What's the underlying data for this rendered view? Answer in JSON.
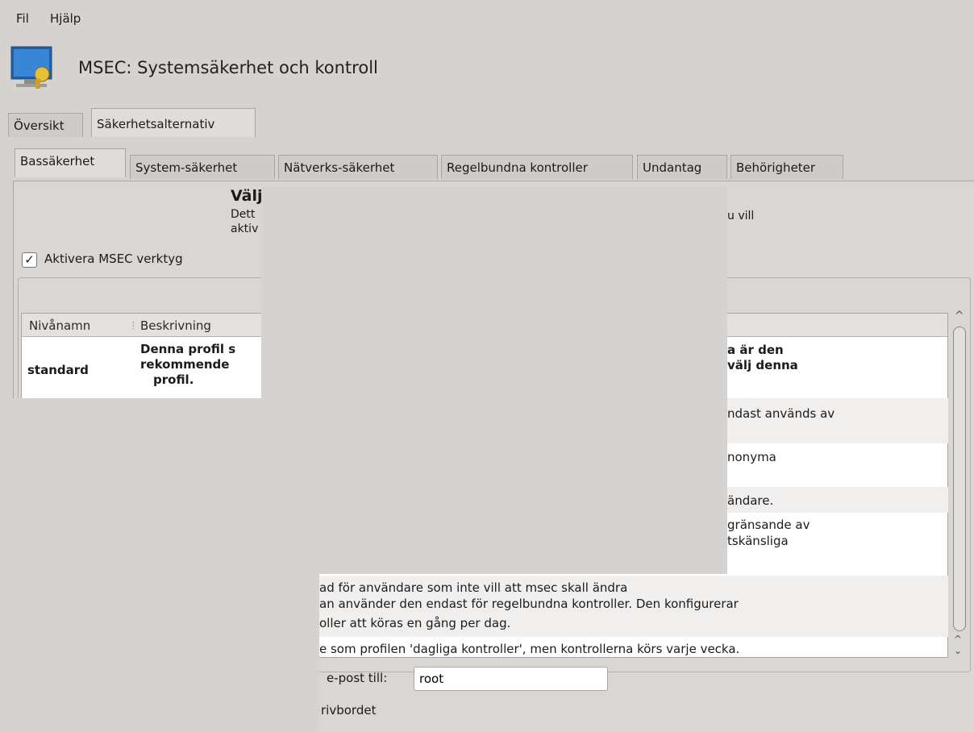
{
  "menubar": {
    "file": "Fil",
    "help": "Hjälp"
  },
  "header": {
    "title": "MSEC: Systemsäkerhet och kontroll"
  },
  "main_tabs": [
    "Översikt",
    "Säkerhetsalternativ"
  ],
  "sub_tabs": [
    "Bassäkerhet",
    "System-säkerhet",
    "Nätverks-säkerhet",
    "Regelbundna kontroller",
    "Undantag",
    "Behörigheter"
  ],
  "section": {
    "heading_fragment": "Välj",
    "desc_line1_fragment": "Dett",
    "desc_line2_fragment": "aktiv",
    "desc_right_fragment": "u vill",
    "checkbox_label": "Aktivera MSEC verktyg"
  },
  "table": {
    "columns": [
      "Nivånamn",
      "Beskrivning"
    ],
    "rows": [
      {
        "name": "standard",
        "desc_left": [
          "Denna profil s",
          "rekommende",
          "profil."
        ],
        "desc_right": [
          "a är den",
          "välj denna"
        ]
      },
      {
        "desc_right": [
          "ndast används av"
        ]
      },
      {
        "desc_right": [
          "nonyma"
        ]
      },
      {
        "desc_right": [
          "ändare."
        ]
      },
      {
        "desc_right": [
          "gränsande av",
          "tskänsliga"
        ]
      },
      {
        "desc": [
          "ad för användare som inte vill att msec skall ändra",
          "an använder den endast för regelbundna kontroller. Den konfigurerar",
          "oller att köras en gång per dag."
        ]
      },
      {
        "desc": [
          "e som profilen 'dagliga kontroller', men kontrollerna körs varje vecka."
        ]
      }
    ]
  },
  "footer": {
    "email_label_fragment": "e-post till:",
    "email_value": "root",
    "desktop_fragment": "rivbordet"
  },
  "check_mark": "✓"
}
